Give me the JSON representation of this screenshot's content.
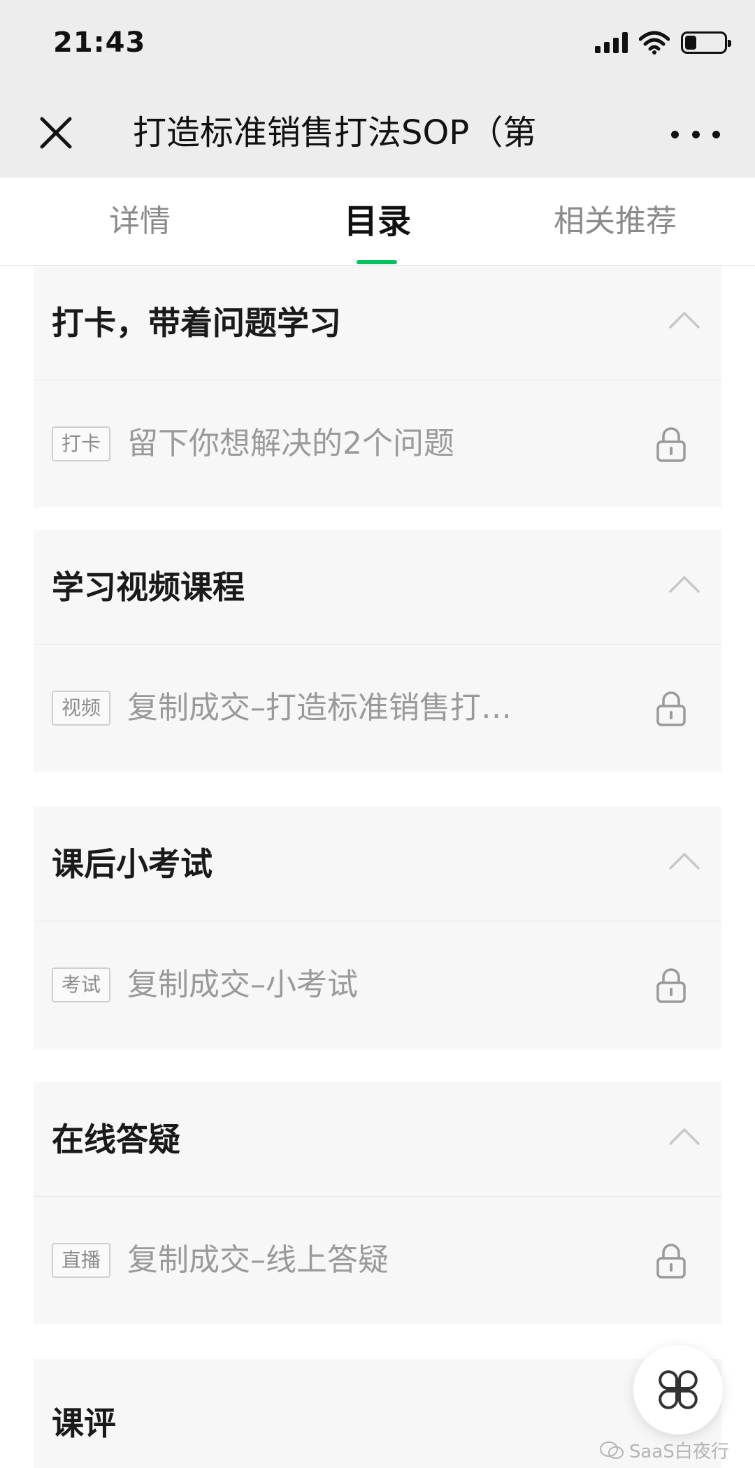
{
  "status_bar": {
    "time": "21:43"
  },
  "navbar": {
    "title": "打造标准销售打法SOP（第"
  },
  "tabs": [
    {
      "label": "详情",
      "active": false
    },
    {
      "label": "目录",
      "active": true
    },
    {
      "label": "相关推荐",
      "active": false
    }
  ],
  "colors": {
    "accent": "#07c160",
    "topbar_bg": "#ededed",
    "section_bg": "#f7f7f8"
  },
  "sections": [
    {
      "title": "打卡，带着问题学习",
      "lesson": {
        "tag": "打卡",
        "title": "留下你想解决的2个问题",
        "icon": "lock-icon"
      }
    },
    {
      "title": "学习视频课程",
      "lesson": {
        "tag": "视频",
        "title": "复制成交–打造标准销售打…",
        "icon": "lock-icon"
      }
    },
    {
      "title": "课后小考试",
      "lesson": {
        "tag": "考试",
        "title": "复制成交–小考试",
        "icon": "lock-icon"
      }
    },
    {
      "title": "在线答疑",
      "lesson": {
        "tag": "直播",
        "title": "复制成交–线上答疑",
        "icon": "lock-icon"
      }
    },
    {
      "title": "课评"
    }
  ],
  "watermark": {
    "text": "SaaS白夜行"
  }
}
